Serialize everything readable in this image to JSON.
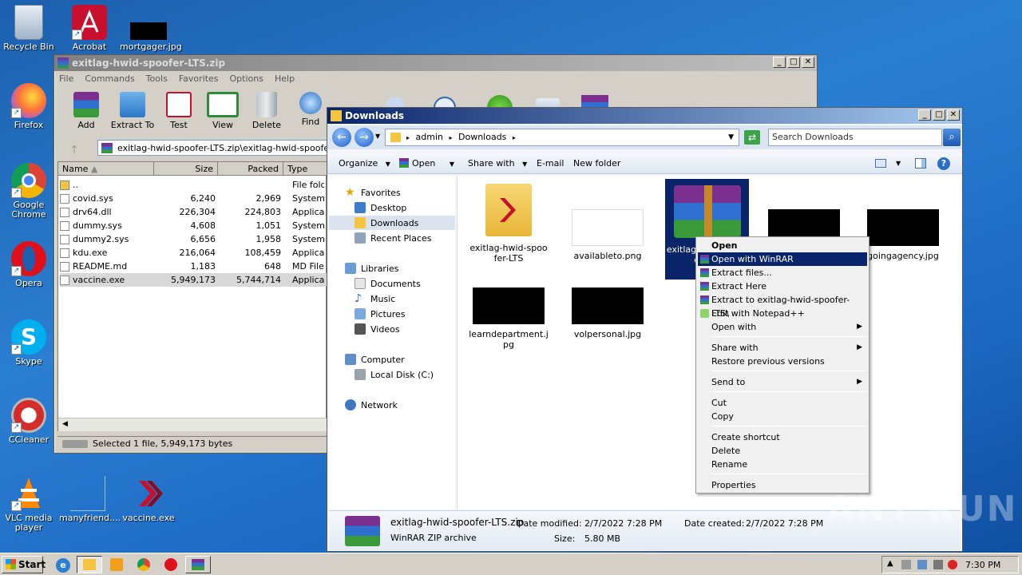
{
  "desktop": {
    "icons": [
      {
        "label": "Recycle Bin"
      },
      {
        "label": "Acrobat"
      },
      {
        "label": "mortgager.jpg"
      },
      {
        "label": "Firefox"
      },
      {
        "label": "Google Chrome"
      },
      {
        "label": "Opera"
      },
      {
        "label": "Skype"
      },
      {
        "label": "CCleaner"
      },
      {
        "label": "VLC media player"
      },
      {
        "label": "manyfriend...."
      },
      {
        "label": "vaccine.exe"
      }
    ]
  },
  "winrar": {
    "title": "exitlag-hwid-spoofer-LTS.zip",
    "menu": [
      "File",
      "Commands",
      "Tools",
      "Favorites",
      "Options",
      "Help"
    ],
    "toolbar": [
      "Add",
      "Extract To",
      "Test",
      "View",
      "Delete",
      "Find"
    ],
    "path": "exitlag-hwid-spoofer-LTS.zip\\exitlag-hwid-spoofer-LTS",
    "columns": [
      "Name",
      "Size",
      "Packed",
      "Type"
    ],
    "rows": [
      {
        "name": "..",
        "size": "",
        "packed": "",
        "type": "File folder"
      },
      {
        "name": "covid.sys",
        "size": "6,240",
        "packed": "2,969",
        "type": "System file"
      },
      {
        "name": "drv64.dll",
        "size": "226,304",
        "packed": "224,803",
        "type": "Application"
      },
      {
        "name": "dummy.sys",
        "size": "4,608",
        "packed": "1,051",
        "type": "System file"
      },
      {
        "name": "dummy2.sys",
        "size": "6,656",
        "packed": "1,958",
        "type": "System file"
      },
      {
        "name": "kdu.exe",
        "size": "216,064",
        "packed": "108,459",
        "type": "Application"
      },
      {
        "name": "README.md",
        "size": "1,183",
        "packed": "648",
        "type": "MD File"
      },
      {
        "name": "vaccine.exe",
        "size": "5,949,173",
        "packed": "5,744,714",
        "type": "Application"
      }
    ],
    "status": "Selected 1 file, 5,949,173 bytes"
  },
  "explorer": {
    "title": "Downloads",
    "breadcrumb": [
      "admin",
      "Downloads"
    ],
    "search_placeholder": "Search Downloads",
    "commands": [
      "Organize",
      "Open",
      "Share with",
      "E-mail",
      "New folder"
    ],
    "nav": {
      "favorites": "Favorites",
      "desktop": "Desktop",
      "downloads": "Downloads",
      "recent": "Recent Places",
      "libraries": "Libraries",
      "documents": "Documents",
      "music": "Music",
      "pictures": "Pictures",
      "videos": "Videos",
      "computer": "Computer",
      "localdisk": "Local Disk (C:)",
      "network": "Network"
    },
    "files": [
      {
        "name": "exitlag-hwid-spoofer-LTS"
      },
      {
        "name": "availableto.png"
      },
      {
        "name": "exitlag-hwid-spoofer-LTS"
      },
      {
        "name": ""
      },
      {
        "name": "goingagency.jpg"
      },
      {
        "name": "learndepartment.jpg"
      },
      {
        "name": "volpersonal.jpg"
      }
    ],
    "details": {
      "filename": "exitlag-hwid-spoofer-LTS.zip",
      "filetype": "WinRAR ZIP archive",
      "modified_label": "Date modified:",
      "modified": "2/7/2022 7:28 PM",
      "size_label": "Size:",
      "size": "5.80 MB",
      "created_label": "Date created:",
      "created": "2/7/2022 7:28 PM"
    }
  },
  "context_menu": {
    "open": "Open",
    "open_winrar": "Open with WinRAR",
    "extract_files": "Extract files...",
    "extract_here": "Extract Here",
    "extract_to": "Extract to exitlag-hwid-spoofer-LTS\\",
    "edit_npp": "Edit with Notepad++",
    "open_with": "Open with",
    "share_with": "Share with",
    "restore": "Restore previous versions",
    "send_to": "Send to",
    "cut": "Cut",
    "copy": "Copy",
    "create_shortcut": "Create shortcut",
    "delete": "Delete",
    "rename": "Rename",
    "properties": "Properties"
  },
  "taskbar": {
    "start": "Start",
    "clock": "7:30 PM"
  },
  "watermark": "ANY RUN",
  "colors": {
    "selection": "#0a246a",
    "titlebar": "#0a246a"
  }
}
